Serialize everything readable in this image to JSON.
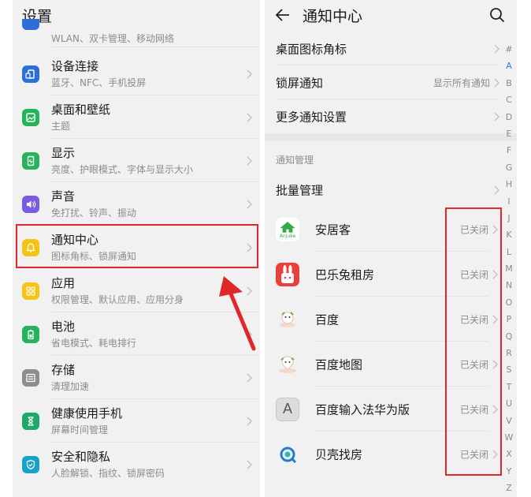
{
  "left": {
    "title": "设置",
    "items": [
      {
        "title": "",
        "subtitle": "WLAN、双卡管理、移动网络",
        "icon": "wifi-icon",
        "color": "#2d6fd7"
      },
      {
        "title": "设备连接",
        "subtitle": "蓝牙、NFC、手机投屏",
        "icon": "device-connect-icon",
        "color": "#2d6fd7"
      },
      {
        "title": "桌面和壁纸",
        "subtitle": "主题",
        "icon": "wallpaper-icon",
        "color": "#27b25e"
      },
      {
        "title": "显示",
        "subtitle": "亮度、护眼模式、字体与显示大小",
        "icon": "display-icon",
        "color": "#27b25e"
      },
      {
        "title": "声音",
        "subtitle": "免打扰、铃声、振动",
        "icon": "sound-icon",
        "color": "#7a5ce0"
      },
      {
        "title": "通知中心",
        "subtitle": "图标角标、锁屏通知",
        "icon": "bell-icon",
        "color": "#f5c316"
      },
      {
        "title": "应用",
        "subtitle": "权限管理、默认应用、应用分身",
        "icon": "apps-icon",
        "color": "#f5c316"
      },
      {
        "title": "电池",
        "subtitle": "省电模式、耗电排行",
        "icon": "battery-icon",
        "color": "#27b25e"
      },
      {
        "title": "存储",
        "subtitle": "清理加速",
        "icon": "storage-icon",
        "color": "#8d8d8d"
      },
      {
        "title": "健康使用手机",
        "subtitle": "屏幕时间管理",
        "icon": "hourglass-icon",
        "color": "#1fa86a"
      },
      {
        "title": "安全和隐私",
        "subtitle": "人脸解锁、指纹、锁屏密码",
        "icon": "shield-icon",
        "color": "#16a3c7"
      }
    ]
  },
  "right": {
    "title": "通知中心",
    "rows": [
      {
        "label": "桌面图标角标",
        "value": ""
      },
      {
        "label": "锁屏通知",
        "value": "显示所有通知"
      },
      {
        "label": "更多通知设置",
        "value": ""
      }
    ],
    "section_label": "通知管理",
    "batch_label": "批量管理",
    "apps": [
      {
        "name": "安居客",
        "status": "已关闭",
        "icon": "anjuke-icon",
        "icon_text": "Anjuke"
      },
      {
        "name": "巴乐兔租房",
        "status": "已关闭",
        "icon": "balerabbit-icon"
      },
      {
        "name": "百度",
        "status": "已关闭",
        "icon": "baidu-icon"
      },
      {
        "name": "百度地图",
        "status": "已关闭",
        "icon": "baidu-map-icon"
      },
      {
        "name": "百度输入法华为版",
        "status": "已关闭",
        "icon": "baidu-input-icon",
        "icon_text": "A"
      },
      {
        "name": "贝壳找房",
        "status": "已关闭",
        "icon": "beike-icon"
      }
    ],
    "alphabet": [
      "#",
      "A",
      "B",
      "C",
      "D",
      "E",
      "F",
      "G",
      "H",
      "I",
      "J",
      "K",
      "L",
      "M",
      "N",
      "O",
      "P",
      "Q",
      "R",
      "S",
      "T",
      "U",
      "V",
      "W",
      "X",
      "Y",
      "Z"
    ],
    "active_letter": "A"
  },
  "colors": {
    "highlight": "#e0282c",
    "accent": "#2e7bd8"
  }
}
